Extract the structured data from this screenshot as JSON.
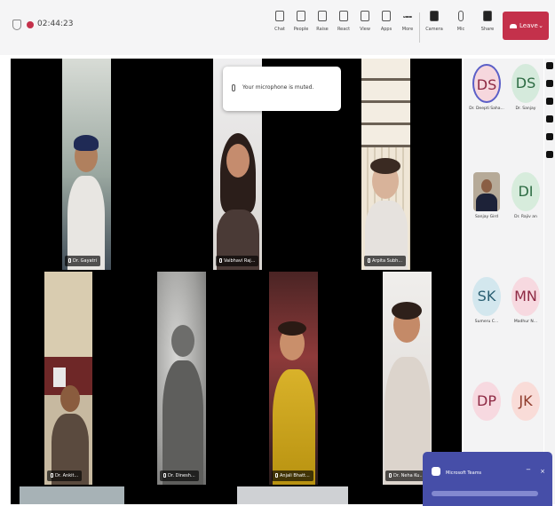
{
  "header": {
    "timer": "02:44:23",
    "leave_label": "Leave",
    "buttons": [
      {
        "label": "Chat",
        "icon": "chat-icon"
      },
      {
        "label": "People",
        "icon": "people-icon"
      },
      {
        "label": "Raise",
        "icon": "raise-hand-icon"
      },
      {
        "label": "React",
        "icon": "react-icon"
      },
      {
        "label": "View",
        "icon": "view-icon"
      },
      {
        "label": "Apps",
        "icon": "apps-icon"
      },
      {
        "label": "More",
        "icon": "more-icon"
      },
      {
        "label": "Camera",
        "icon": "camera-icon"
      },
      {
        "label": "Mic",
        "icon": "mic-icon"
      },
      {
        "label": "Share",
        "icon": "share-icon"
      }
    ]
  },
  "notification": {
    "text": "Your microphone is muted."
  },
  "tiles": [
    {
      "name": "Dr. Gayatri"
    },
    {
      "name": "Vaibhavi Raj..."
    },
    {
      "name": "Arpita Subh..."
    },
    {
      "name": "Dr. Ankit..."
    },
    {
      "name": "Dr. Dinesh..."
    },
    {
      "name": "Anjali Bhatt..."
    },
    {
      "name": "Dr. Neha Ku..."
    }
  ],
  "roster": [
    {
      "initials": "DS",
      "name": "Dr. Deepti Saha...",
      "bg": "#f6d7dd",
      "fg": "#8e2a44"
    },
    {
      "initials": "DS",
      "name": "Dr. Sanjay",
      "bg": "#d5eadc",
      "fg": "#2d6b43"
    },
    {
      "initials": "",
      "name": "Sanjay Gird",
      "bg": "#b6aa98",
      "fg": "#000000"
    },
    {
      "initials": "DI",
      "name": "Dr. Rajiv an",
      "bg": "#d7ecdc",
      "fg": "#2d6b43"
    },
    {
      "initials": "SK",
      "name": "Sumeru C...",
      "bg": "#d3e7ee",
      "fg": "#2a5f72"
    },
    {
      "initials": "MN",
      "name": "Madhur N...",
      "bg": "#f7d9e0",
      "fg": "#8e2a44"
    },
    {
      "initials": "DP",
      "name": "",
      "bg": "#f7d9e0",
      "fg": "#8e2a44"
    },
    {
      "initials": "JK",
      "name": "",
      "bg": "#f9dcd8",
      "fg": "#8e3a2a"
    }
  ],
  "chat_popup": {
    "title": "Microsoft Teams"
  },
  "colors": {
    "leave": "#c4314b",
    "teams_purple": "#464ea8"
  }
}
